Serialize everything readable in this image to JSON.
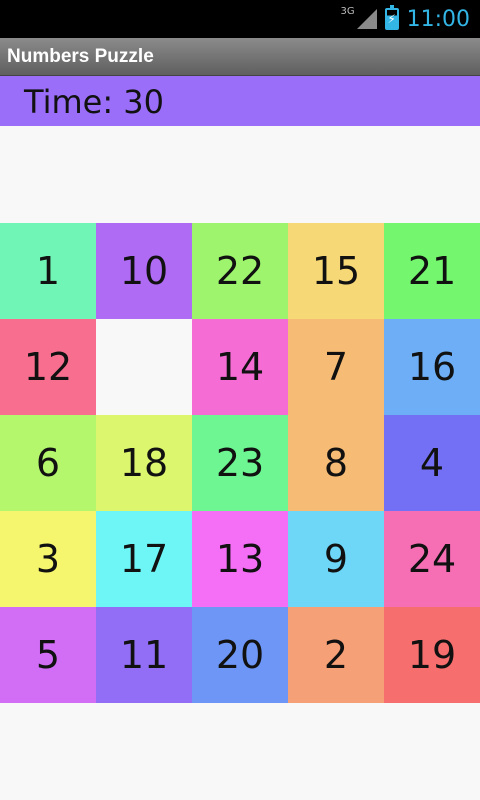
{
  "status_bar": {
    "network": "3G",
    "time": "11:00",
    "icons": [
      "signal-icon",
      "battery-icon"
    ]
  },
  "app": {
    "title": "Numbers Puzzle"
  },
  "timer": {
    "label": "Time: 30"
  },
  "puzzle": {
    "rows": 5,
    "cols": 5,
    "tiles": [
      {
        "value": "1",
        "color": "#70f5b6"
      },
      {
        "value": "10",
        "color": "#b06bf5"
      },
      {
        "value": "22",
        "color": "#9ef56d"
      },
      {
        "value": "15",
        "color": "#f7d876"
      },
      {
        "value": "21",
        "color": "#74f66e"
      },
      {
        "value": "12",
        "color": "#f76e8f"
      },
      {
        "value": "",
        "color": "#f8f8f8",
        "empty": true
      },
      {
        "value": "14",
        "color": "#f56cd4"
      },
      {
        "value": "7",
        "color": "#f6bc75"
      },
      {
        "value": "16",
        "color": "#6eaef6"
      },
      {
        "value": "6",
        "color": "#b4f76d"
      },
      {
        "value": "18",
        "color": "#dcf76e"
      },
      {
        "value": "23",
        "color": "#6ef693"
      },
      {
        "value": "8",
        "color": "#f6bc75"
      },
      {
        "value": "4",
        "color": "#7370f5"
      },
      {
        "value": "3",
        "color": "#f6f66e"
      },
      {
        "value": "17",
        "color": "#6ef6f6"
      },
      {
        "value": "13",
        "color": "#f56ef6"
      },
      {
        "value": "9",
        "color": "#6ed6f6"
      },
      {
        "value": "24",
        "color": "#f66eb4"
      },
      {
        "value": "5",
        "color": "#d26ef6"
      },
      {
        "value": "11",
        "color": "#926ef6"
      },
      {
        "value": "20",
        "color": "#6e96f6"
      },
      {
        "value": "2",
        "color": "#f6a077"
      },
      {
        "value": "19",
        "color": "#f66e6e"
      }
    ]
  }
}
